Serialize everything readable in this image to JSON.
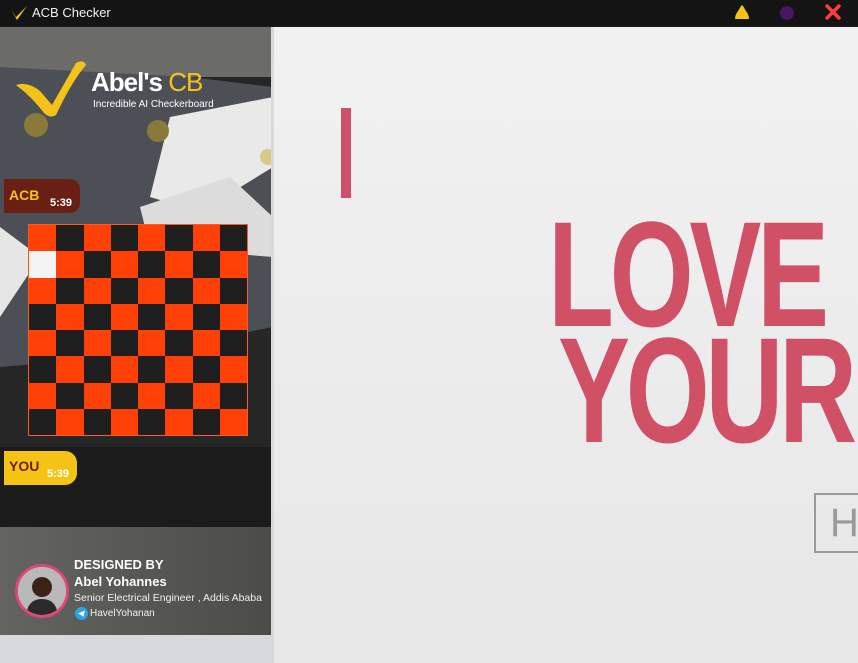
{
  "window": {
    "title": "ACB Checker",
    "controls": {
      "minimize_color": "#f5c315",
      "maximize_color": "#4a1560",
      "close_color": "#ff3b3b"
    }
  },
  "brand": {
    "name_main": "Abel's ",
    "name_accent": "CB",
    "tagline": "Incredible AI Checkerboard"
  },
  "players": {
    "opponent": {
      "name": "ACB",
      "time": "5:39"
    },
    "user": {
      "name": "YOU",
      "time": "5:39"
    }
  },
  "board": {
    "size": 8,
    "colors": {
      "light": "#ff4107",
      "dark": "#1f1f1f",
      "highlight": "#f4f4f4"
    },
    "highlighted_square": {
      "row": 1,
      "col": 0
    }
  },
  "credits": {
    "designed_by": "DESIGNED BY",
    "designer_name": "Abel Yohannes",
    "designer_role": "Senior Electrical Engineer , Addis Ababa",
    "handle": "HavelYohanan"
  },
  "main_view": {
    "line1": "LOVE",
    "line2": "YOUR",
    "hint_letter": "H",
    "text_color": "#d05066"
  }
}
